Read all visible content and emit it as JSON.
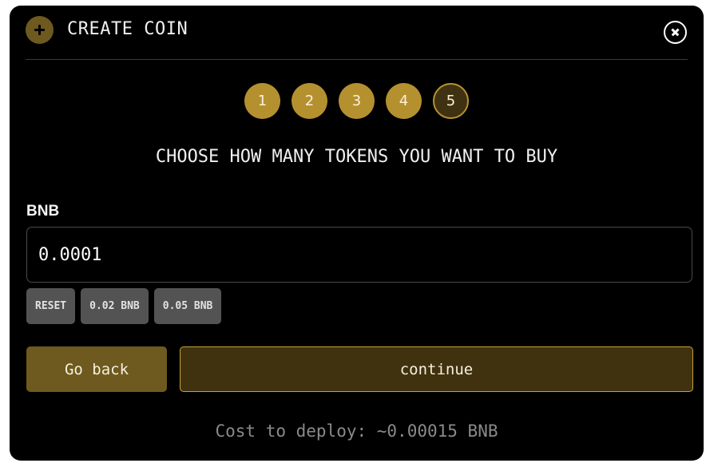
{
  "header": {
    "title": "CREATE COIN",
    "leading_icon": "plus-circle-icon",
    "close_icon": "close-circle-icon"
  },
  "steps": {
    "labels": [
      "1",
      "2",
      "3",
      "4",
      "5"
    ],
    "current": 5
  },
  "heading": "CHOOSE HOW MANY TOKENS YOU WANT TO BUY",
  "amount_field": {
    "label": "BNB",
    "value": "0.0001"
  },
  "presets": {
    "reset": "RESET",
    "option_1": "0.02 BNB",
    "option_2": "0.05 BNB"
  },
  "actions": {
    "back": "Go back",
    "continue": "continue"
  },
  "cost_text": "Cost to deploy: ~0.00015 BNB",
  "colors": {
    "accent_gold": "#b5902f",
    "accent_dark_gold": "#6e5a1e",
    "background": "#000000",
    "preset_gray": "#535353"
  }
}
